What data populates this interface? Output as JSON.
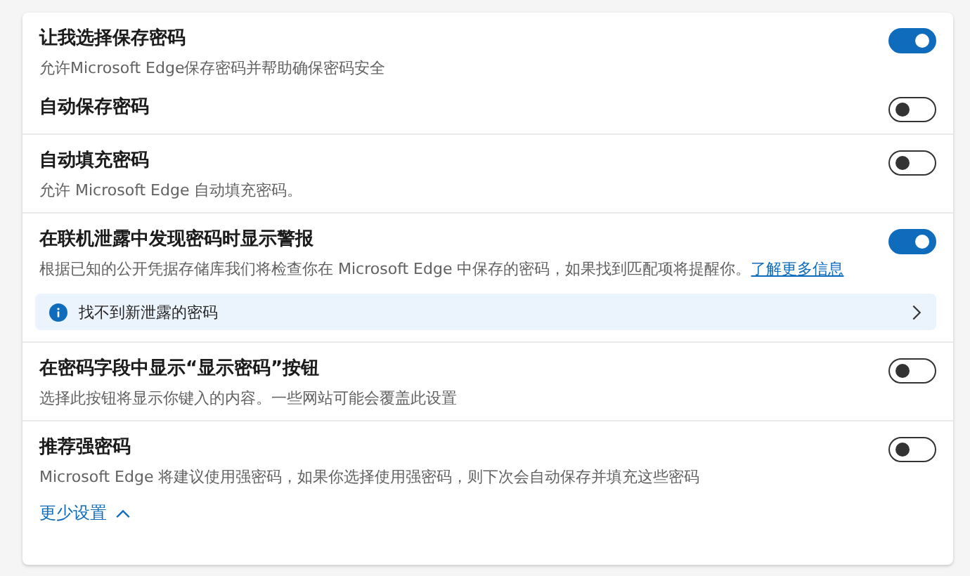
{
  "sections": [
    {
      "items": [
        {
          "title": "让我选择保存密码",
          "description": "允许Microsoft Edge保存密码并帮助确保密码安全",
          "on": true
        },
        {
          "title": "自动保存密码",
          "on": false
        }
      ]
    },
    {
      "items": [
        {
          "title": "自动填充密码",
          "description": "允许 Microsoft Edge 自动填充密码。",
          "on": false
        }
      ]
    },
    {
      "items": [
        {
          "title": "在联机泄露中发现密码时显示警报",
          "description": "根据已知的公开凭据存储库我们将检查你在 Microsoft Edge 中保存的密码，如果找到匹配项将提醒你。",
          "link": "了解更多信息",
          "on": true
        }
      ],
      "notice": {
        "text": "找不到新泄露的密码"
      }
    },
    {
      "items": [
        {
          "title": "在密码字段中显示“显示密码”按钮",
          "description": "选择此按钮将显示你键入的内容。一些网站可能会覆盖此设置",
          "on": false
        }
      ]
    },
    {
      "items": [
        {
          "title": "推荐强密码",
          "description": "Microsoft Edge 将建议使用强密码，如果你选择使用强密码，则下次会自动保存并填充这些密码",
          "on": false
        }
      ]
    }
  ],
  "footer_link": "更少设置"
}
